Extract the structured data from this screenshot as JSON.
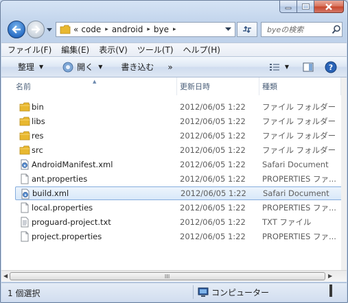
{
  "address": {
    "overflow": "«",
    "crumbs": [
      "code",
      "android",
      "bye"
    ]
  },
  "search": {
    "placeholder": "byeの検索"
  },
  "menu": [
    "ファイル(F)",
    "編集(E)",
    "表示(V)",
    "ツール(T)",
    "ヘルプ(H)"
  ],
  "toolbar": {
    "organize": "整理",
    "open": "開く",
    "burn": "書き込む",
    "more": "»"
  },
  "columns": {
    "name": "名前",
    "date": "更新日時",
    "type": "種類"
  },
  "files": [
    {
      "name": "bin",
      "date": "2012/06/05 1:22",
      "type": "ファイル フォルダー",
      "icon": "folder-icon"
    },
    {
      "name": "libs",
      "date": "2012/06/05 1:22",
      "type": "ファイル フォルダー",
      "icon": "folder-icon"
    },
    {
      "name": "res",
      "date": "2012/06/05 1:22",
      "type": "ファイル フォルダー",
      "icon": "folder-icon"
    },
    {
      "name": "src",
      "date": "2012/06/05 1:22",
      "type": "ファイル フォルダー",
      "icon": "folder-icon"
    },
    {
      "name": "AndroidManifest.xml",
      "date": "2012/06/05 1:22",
      "type": "Safari Document",
      "icon": "safari-document-icon"
    },
    {
      "name": "ant.properties",
      "date": "2012/06/05 1:22",
      "type": "PROPERTIES ファ...",
      "icon": "blank-file-icon"
    },
    {
      "name": "build.xml",
      "date": "2012/06/05 1:22",
      "type": "Safari Document",
      "icon": "safari-document-icon",
      "selected": true
    },
    {
      "name": "local.properties",
      "date": "2012/06/05 1:22",
      "type": "PROPERTIES ファ...",
      "icon": "blank-file-icon"
    },
    {
      "name": "proguard-project.txt",
      "date": "2012/06/05 1:22",
      "type": "TXT ファイル",
      "icon": "text-file-icon"
    },
    {
      "name": "project.properties",
      "date": "2012/06/05 1:22",
      "type": "PROPERTIES ファ...",
      "icon": "blank-file-icon"
    }
  ],
  "status": {
    "selection": "1 個選択",
    "location": "コンピューター"
  },
  "colors": {
    "selection_border": "#84acdd",
    "selection_fill": "#d8e8f9",
    "folder": "#e8b830"
  }
}
